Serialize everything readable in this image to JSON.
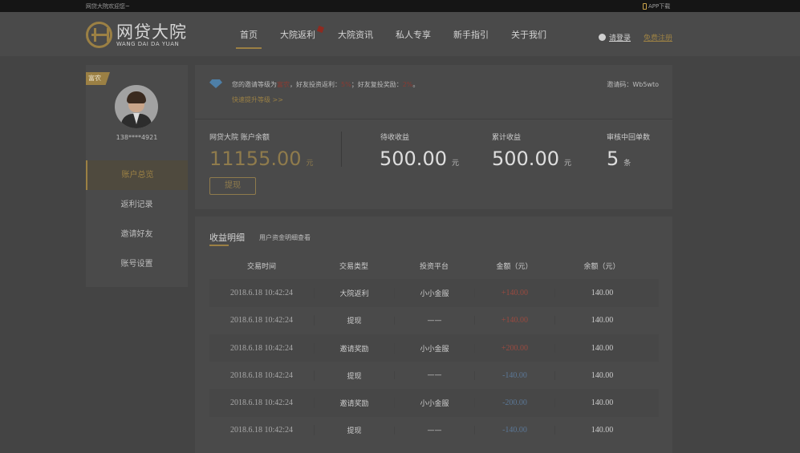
{
  "topbar": {
    "welcome": "网贷大院欢迎您~",
    "app_download": "APP下载"
  },
  "logo": {
    "cn": "网贷大院",
    "en": "WANG DAI DA YUAN"
  },
  "nav": [
    {
      "label": "首页",
      "active": true
    },
    {
      "label": "大院返利",
      "badge": true
    },
    {
      "label": "大院资讯"
    },
    {
      "label": "私人专享"
    },
    {
      "label": "新手指引"
    },
    {
      "label": "关于我们"
    }
  ],
  "auth": {
    "login": "请登录",
    "register": "免费注册"
  },
  "sidebar": {
    "level_tag": "富农",
    "user_id": "138****4921",
    "menu": [
      {
        "label": "账户总览",
        "active": true
      },
      {
        "label": "返利记录"
      },
      {
        "label": "邀请好友"
      },
      {
        "label": "账号设置"
      }
    ]
  },
  "account": {
    "invite_prefix": "您的邀请等级为",
    "invite_level": "富农",
    "invite_mid1": "，好友投资返利：",
    "invest_rate": "5%",
    "invite_mid2": "；好友复投奖励：",
    "reinvest_rate": "2%",
    "invite_suffix": "。",
    "upgrade_link": "快速提升等级 >>",
    "invite_code_label": "邀请码：Wb5wto",
    "balance_label": "网贷大院 账户余额",
    "balance_value": "11155.00",
    "balance_unit": "元",
    "withdraw_label": "提现",
    "pending_label": "待收收益",
    "pending_value": "500.00",
    "pending_unit": "元",
    "total_label": "累计收益",
    "total_value": "500.00",
    "total_unit": "元",
    "review_label": "审核中回单数",
    "review_value": "5",
    "review_unit": "条"
  },
  "income": {
    "title": "收益明细",
    "subtitle": "用户资金明细查看",
    "headers": [
      "交易时间",
      "交易类型",
      "投资平台",
      "金额（元）",
      "余额（元）"
    ],
    "rows": [
      {
        "time": "2018.6.18 10:42:24",
        "type": "大院返利",
        "platform": "小小金服",
        "amount": "+140.00",
        "balance": "140.00",
        "sign": "pos"
      },
      {
        "time": "2018.6.18 10:42:24",
        "type": "提现",
        "platform": "——",
        "amount": "+140.00",
        "balance": "140.00",
        "sign": "pos"
      },
      {
        "time": "2018.6.18 10:42:24",
        "type": "邀请奖励",
        "platform": "小小金服",
        "amount": "+200.00",
        "balance": "140.00",
        "sign": "pos"
      },
      {
        "time": "2018.6.18 10:42:24",
        "type": "提现",
        "platform": "——",
        "amount": "-140.00",
        "balance": "140.00",
        "sign": "neg"
      },
      {
        "time": "2018.6.18 10:42:24",
        "type": "邀请奖励",
        "platform": "小小金服",
        "amount": "-200.00",
        "balance": "140.00",
        "sign": "neg"
      },
      {
        "time": "2018.6.18 10:42:24",
        "type": "提现",
        "platform": "——",
        "amount": "-140.00",
        "balance": "140.00",
        "sign": "neg"
      }
    ]
  },
  "colors": {
    "gold": "#9b8044",
    "positive": "#9a4a40",
    "negative": "#5b7796",
    "overlay": "#444444"
  }
}
